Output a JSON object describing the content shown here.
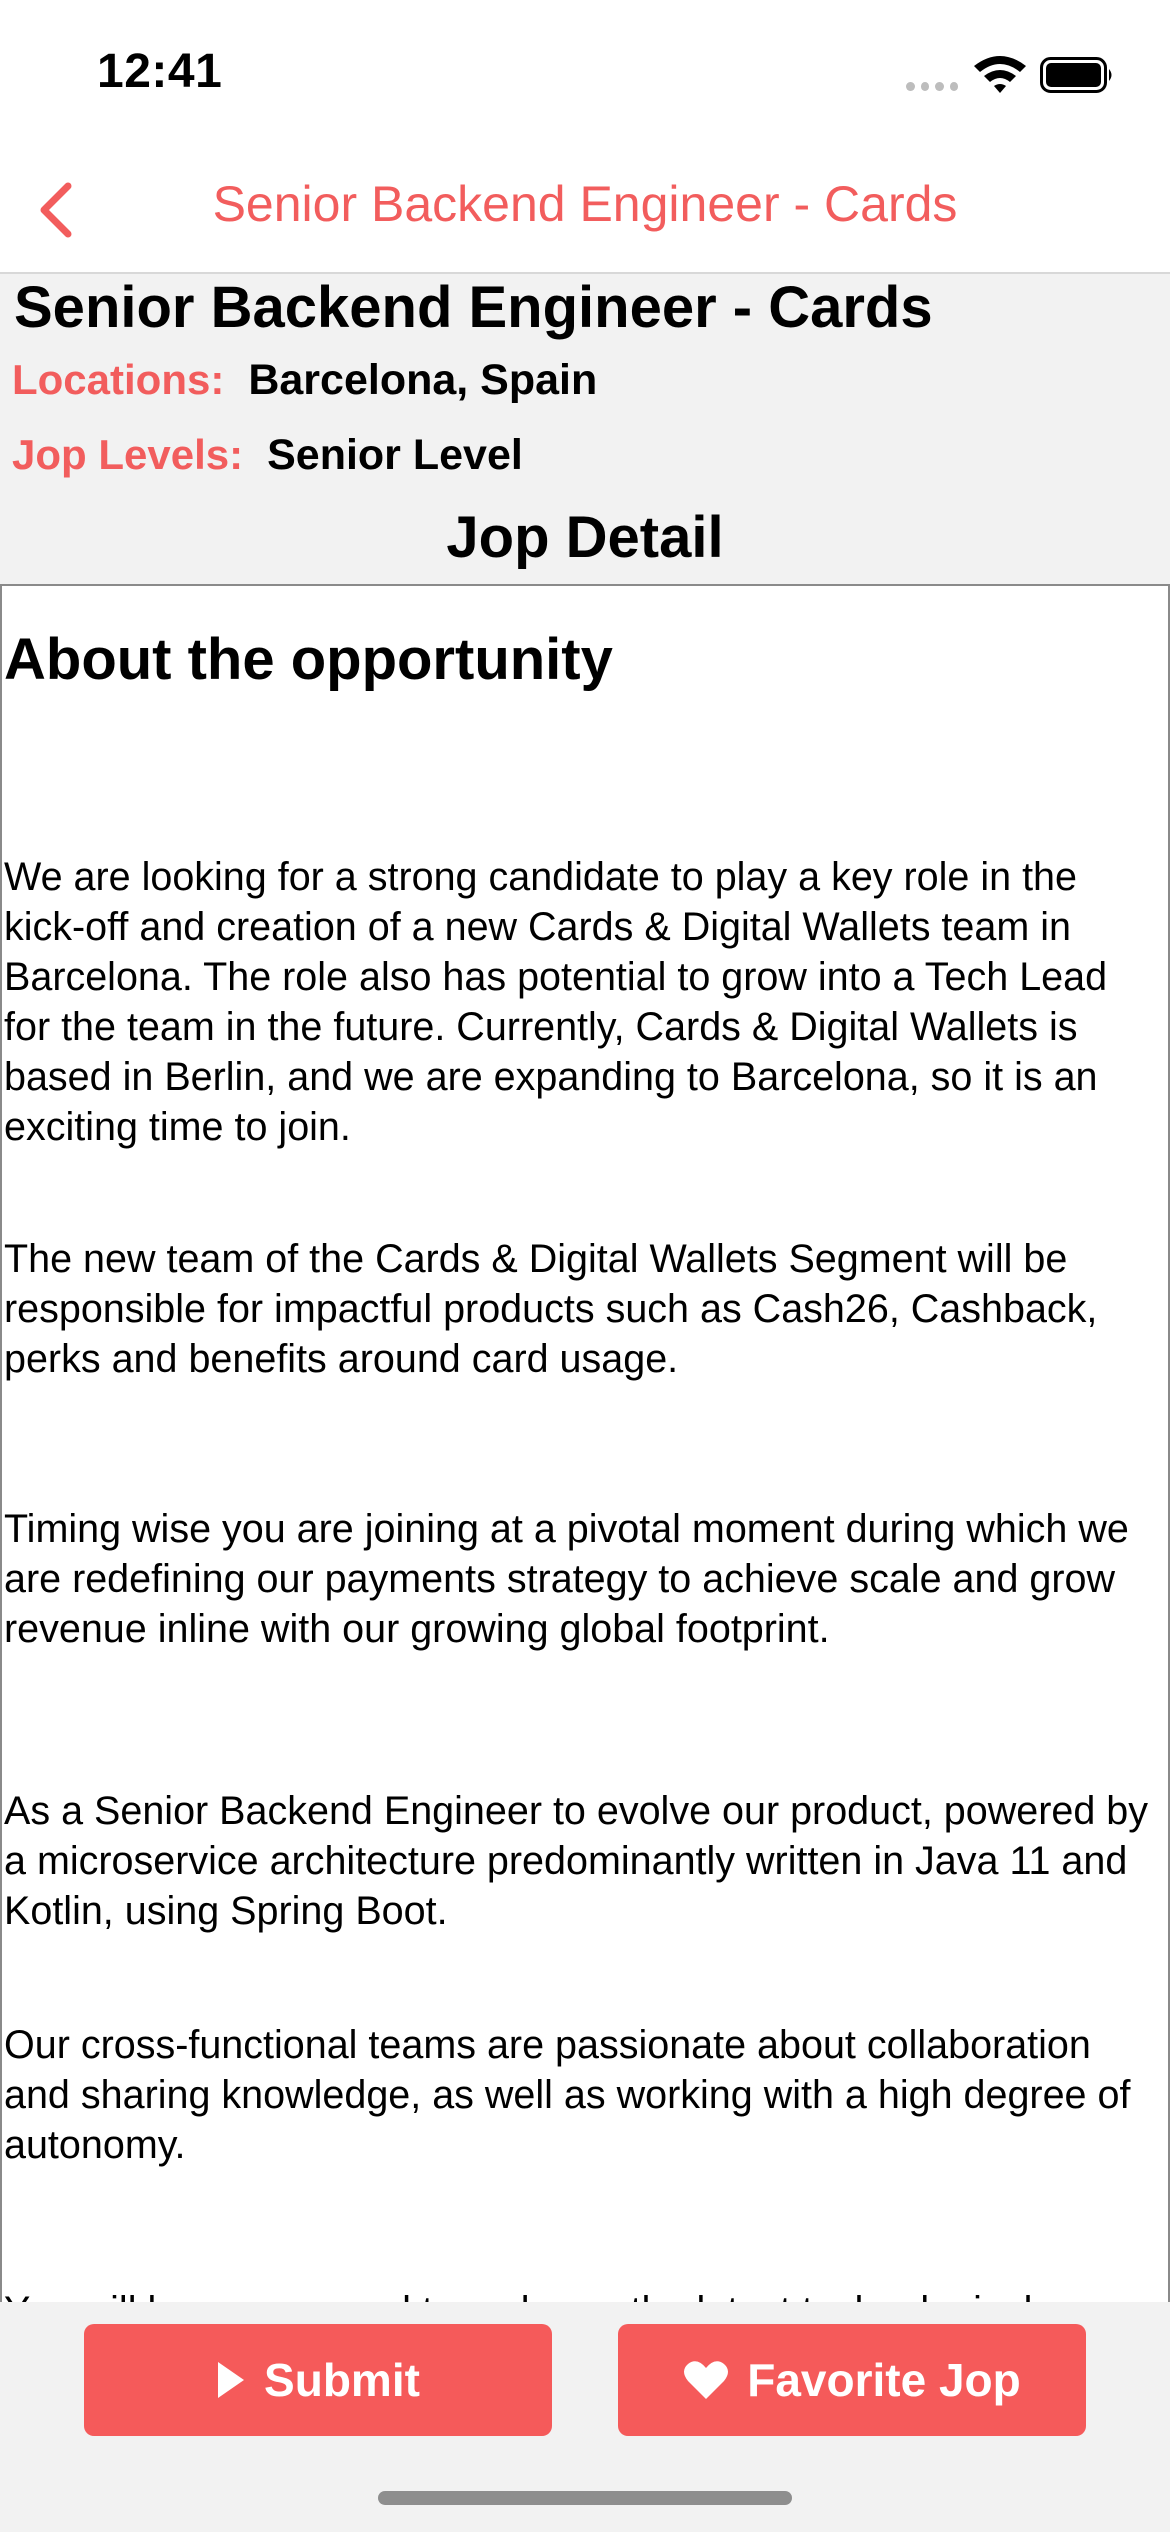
{
  "status_bar": {
    "time": "12:41"
  },
  "nav": {
    "title": "Senior Backend Engineer - Cards",
    "back_icon": "chevron-left-icon"
  },
  "job": {
    "title": "Senior Backend Engineer - Cards",
    "locations_label": "Locations:",
    "locations_value": "Barcelona, Spain",
    "levels_label": "Jop Levels:",
    "levels_value": "Senior Level",
    "section_title": "Jop Detail"
  },
  "detail": {
    "heading": "About the opportunity",
    "paragraphs": [
      "We are looking for a strong candidate to play a key role in the kick-off and creation of a new Cards & Digital Wallets team in Barcelona. The role also has potential to grow into a Tech Lead for the team in the future. Currently, Cards & Digital Wallets is based in Berlin, and we are expanding to Barcelona, so it is an exciting time to join.",
      "The new team of the Cards & Digital Wallets Segment will be responsible for impactful products such as Cash26, Cashback, perks and benefits around card usage.",
      "Timing wise you are joining at a pivotal moment during which we are redefining our payments strategy to achieve scale and grow revenue inline with our growing global footprint.",
      "As a Senior Backend Engineer to evolve our product, powered by a microservice architecture predominantly written in Java 11 and Kotlin, using Spring Boot.",
      "Our cross-functional teams are passionate about collaboration and sharing knowledge, as well as working with a high degree of autonomy.",
      "You will be encouraged to embrace the latest technological updates and given a platform to work on complex"
    ]
  },
  "actions": {
    "submit_label": "Submit",
    "submit_icon": "play-icon",
    "favorite_label": "Favorite Jop",
    "favorite_icon": "heart-icon"
  },
  "colors": {
    "accent": "#f25d5d",
    "button": "#f55a5a",
    "panel_bg": "#f2f2f2"
  }
}
